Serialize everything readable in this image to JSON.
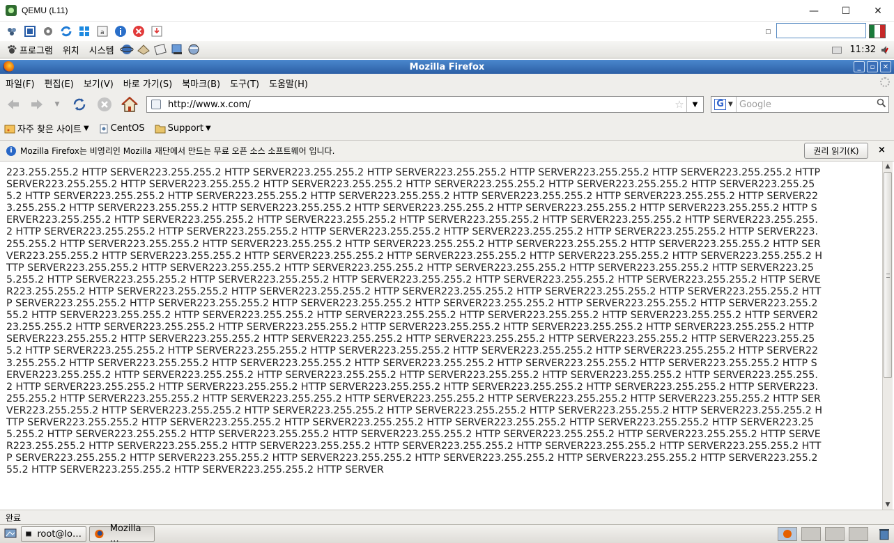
{
  "qemu": {
    "title": "QEMU (L11)",
    "controls": {
      "minimize": "—",
      "maximize": "☐",
      "close": "✕"
    },
    "toolbar_icons": [
      "plugin-icon",
      "fullscreen-icon",
      "settings-icon",
      "refresh-icon",
      "windows-icon",
      "terminal-icon",
      "info-icon",
      "stop-icon",
      "download-icon"
    ]
  },
  "gnome_panel": {
    "menus": [
      "프로그램",
      "위치",
      "시스템"
    ],
    "clock": "11:32"
  },
  "firefox": {
    "title": "Mozilla Firefox",
    "menu": [
      "파일(F)",
      "편집(E)",
      "보기(V)",
      "바로 가기(S)",
      "북마크(B)",
      "도구(T)",
      "도움말(H)"
    ],
    "url": "http://www.x.com/",
    "search_placeholder": "Google",
    "search_engine_label": "G",
    "bookmarks": [
      "자주 찾은 사이트",
      "CentOS",
      "Support"
    ],
    "notification": {
      "text": "Mozilla Firefox는 비영리인 Mozilla 재단에서 만드는 무료 오픈 소스 소프트웨어 입니다.",
      "button": "권리 읽기(K)",
      "close": "×"
    },
    "page": {
      "repeat_unit": "223.255.255.2 HTTP SERVER",
      "repeat_count": 145
    },
    "status": "완료"
  },
  "taskbar": {
    "items": [
      "root@lo…",
      "Mozilla …"
    ]
  },
  "colors": {
    "ff_title": "#2c5fa5",
    "chrome": "#efeeeb",
    "qemu_input_border": "#5a8dc4"
  }
}
